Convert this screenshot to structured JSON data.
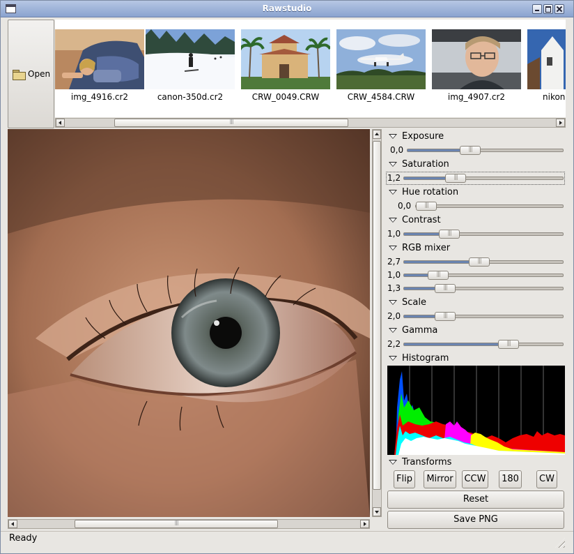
{
  "window": {
    "title": "Rawstudio"
  },
  "toolbar": {
    "open_label": "Open"
  },
  "thumbnails": [
    {
      "name": "img_4916.cr2"
    },
    {
      "name": "canon-350d.cr2"
    },
    {
      "name": "CRW_0049.CRW"
    },
    {
      "name": "CRW_4584.CRW"
    },
    {
      "name": "img_4907.cr2"
    },
    {
      "name": "nikon"
    }
  ],
  "tools": {
    "exposure": {
      "label": "Exposure",
      "value": "0,0",
      "fraction": 0.39
    },
    "saturation": {
      "label": "Saturation",
      "value": "1,2",
      "fraction": 0.3
    },
    "hue_rotation": {
      "label": "Hue rotation",
      "value": "0,0",
      "fraction": 0.0
    },
    "contrast": {
      "label": "Contrast",
      "value": "1,0",
      "fraction": 0.25
    },
    "rgb_mixer": {
      "label": "RGB mixer",
      "channels": [
        {
          "value": "2,7",
          "fraction": 0.47
        },
        {
          "value": "1,0",
          "fraction": 0.17
        },
        {
          "value": "1,3",
          "fraction": 0.22
        }
      ]
    },
    "scale": {
      "label": "Scale",
      "value": "2,0",
      "fraction": 0.22
    },
    "gamma": {
      "label": "Gamma",
      "value": "2,2",
      "fraction": 0.68
    },
    "histogram": {
      "label": "Histogram"
    },
    "transforms": {
      "label": "Transforms",
      "buttons": [
        "Flip",
        "Mirror",
        "CCW",
        "180",
        "CW"
      ]
    },
    "reset_label": "Reset",
    "save_label": "Save PNG"
  },
  "status": {
    "text": "Ready"
  },
  "colors": {
    "title_bar": "#8aa3cf",
    "slider_fill": "#6a84b0",
    "histogram_bg": "#000000"
  }
}
